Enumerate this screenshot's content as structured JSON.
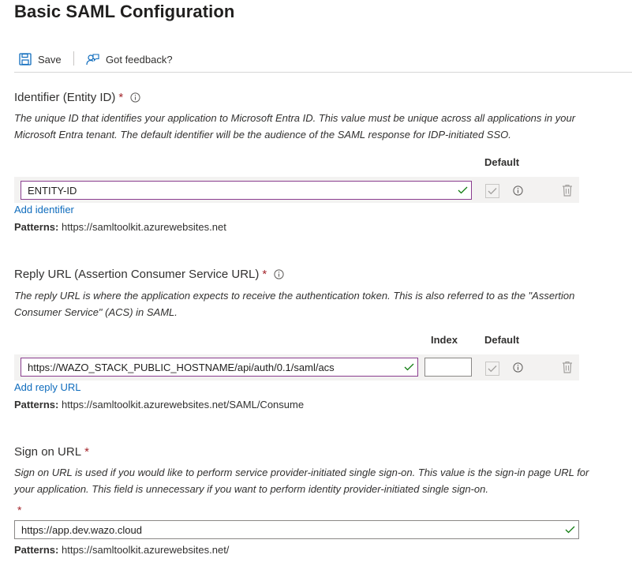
{
  "page": {
    "title": "Basic SAML Configuration"
  },
  "toolbar": {
    "save_label": "Save",
    "feedback_label": "Got feedback?"
  },
  "colors": {
    "required": "#a4262c",
    "link": "#0f6cbd",
    "focus_border": "#8a3d8f",
    "valid_check": "#107c10"
  },
  "identifier": {
    "heading": "Identifier (Entity ID)",
    "required_mark": "*",
    "description": "The unique ID that identifies your application to Microsoft Entra ID. This value must be unique across all applications in your Microsoft Entra tenant. The default identifier will be the audience of the SAML response for IDP-initiated SSO.",
    "default_header": "Default",
    "value": "ENTITY-ID",
    "add_link": "Add identifier",
    "patterns_label": "Patterns:",
    "patterns_value": "https://samltoolkit.azurewebsites.net"
  },
  "reply_url": {
    "heading": "Reply URL (Assertion Consumer Service URL)",
    "required_mark": "*",
    "description": "The reply URL is where the application expects to receive the authentication token. This is also referred to as the \"Assertion Consumer Service\" (ACS) in SAML.",
    "index_header": "Index",
    "default_header": "Default",
    "value": "https://WAZO_STACK_PUBLIC_HOSTNAME/api/auth/0.1/saml/acs",
    "index_value": "",
    "add_link": "Add reply URL",
    "patterns_label": "Patterns:",
    "patterns_value": "https://samltoolkit.azurewebsites.net/SAML/Consume"
  },
  "sign_on": {
    "heading": "Sign on URL",
    "required_mark": "*",
    "description": "Sign on URL is used if you would like to perform service provider-initiated single sign-on. This value is the sign-in page URL for your application. This field is unnecessary if you want to perform identity provider-initiated single sign-on.",
    "field_required_mark": "*",
    "value": "https://app.dev.wazo.cloud",
    "patterns_label": "Patterns:",
    "patterns_value": "https://samltoolkit.azurewebsites.net/"
  }
}
